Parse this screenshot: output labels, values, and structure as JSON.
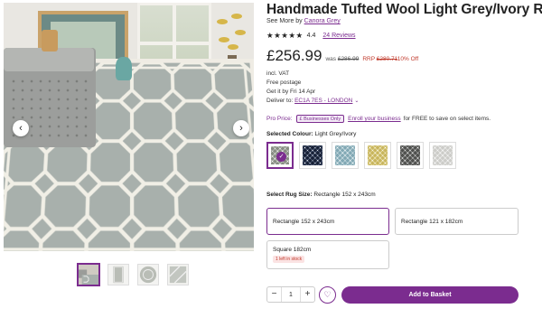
{
  "product": {
    "title": "Handmade Tufted Wool Light Grey/Ivory Rug",
    "see_more_prefix": "See More by",
    "brand": "Canora Grey",
    "stars": "★★★★★",
    "rating": "4.4",
    "reviews": "24 Reviews"
  },
  "pricing": {
    "price": "£256.99",
    "was_prefix": "was",
    "was_price": "£286.99",
    "rrp_prefix": "RRP",
    "rrp_price": "£280.71",
    "discount": "10% Off"
  },
  "details": {
    "vat": "incl. VAT",
    "postage": "Free postage",
    "delivery": "Get it by Fri 14 Apr",
    "deliver_to_label": "Deliver to:",
    "postcode": "EC1A 7ES - LONDON"
  },
  "pro": {
    "label": "Pro Price:",
    "currency": "£",
    "badge": "Businesses Only",
    "link": "Enroll your business",
    "rest": "for FREE to save on select items."
  },
  "colour": {
    "label": "Selected Colour:",
    "value": "Light Grey/Ivory",
    "swatches": [
      {
        "name": "light-grey-ivory",
        "color": "#b9bdb6",
        "selected": true
      },
      {
        "name": "navy",
        "color": "#4d5a74",
        "selected": false
      },
      {
        "name": "light-blue",
        "color": "#b6cfd6",
        "selected": false
      },
      {
        "name": "yellow",
        "color": "#e2d79a",
        "selected": false
      },
      {
        "name": "grey",
        "color": "#8d8e8c",
        "selected": false
      },
      {
        "name": "white-grey",
        "color": "#e4e4e2",
        "selected": false
      }
    ]
  },
  "size": {
    "label": "Select Rug Size:",
    "value": "Rectangle 152 x 243cm",
    "options": [
      {
        "label": "Rectangle 152 x 243cm",
        "selected": true
      },
      {
        "label": "Rectangle 121 x 182cm",
        "selected": false
      },
      {
        "label": "Square 182cm",
        "stock": "1 left in stock",
        "selected": false
      }
    ]
  },
  "purchase": {
    "quantity": "1",
    "minus": "−",
    "plus": "+",
    "wishlist_icon": "♡",
    "add_to_basket": "Add to Basket"
  },
  "gallery": {
    "prev": "‹",
    "next": "›",
    "thumb_count": 4
  },
  "colors": {
    "accent": "#7b2c8f",
    "sale": "#c0392b"
  }
}
